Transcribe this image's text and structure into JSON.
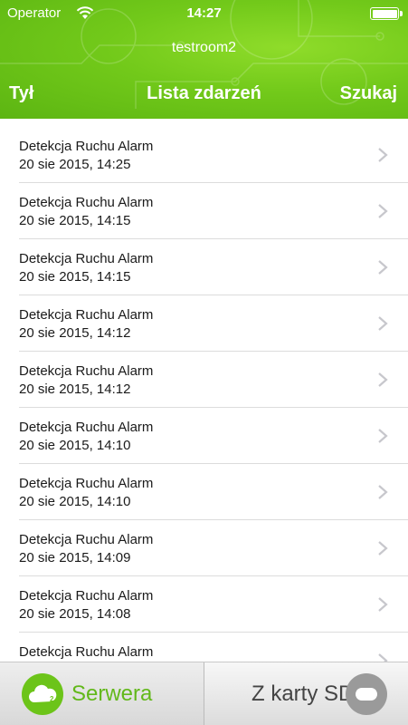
{
  "status_bar": {
    "carrier": "Operator",
    "time": "14:27",
    "icons": [
      "wifi-icon",
      "battery-icon"
    ]
  },
  "header": {
    "subtitle": "testroom2",
    "back_label": "Tył",
    "title": "Lista zdarzeń",
    "search_label": "Szukaj",
    "accent_color": "#72c91a"
  },
  "events": [
    {
      "title": "Detekcja Ruchu Alarm",
      "time": "20 sie 2015, 14:25"
    },
    {
      "title": "Detekcja Ruchu Alarm",
      "time": "20 sie 2015, 14:15"
    },
    {
      "title": "Detekcja Ruchu Alarm",
      "time": "20 sie 2015, 14:15"
    },
    {
      "title": "Detekcja Ruchu Alarm",
      "time": "20 sie 2015, 14:12"
    },
    {
      "title": "Detekcja Ruchu Alarm",
      "time": "20 sie 2015, 14:12"
    },
    {
      "title": "Detekcja Ruchu Alarm",
      "time": "20 sie 2015, 14:10"
    },
    {
      "title": "Detekcja Ruchu Alarm",
      "time": "20 sie 2015, 14:10"
    },
    {
      "title": "Detekcja Ruchu Alarm",
      "time": "20 sie 2015, 14:09"
    },
    {
      "title": "Detekcja Ruchu Alarm",
      "time": "20 sie 2015, 14:08"
    },
    {
      "title": "Detekcja Ruchu Alarm",
      "time": ""
    }
  ],
  "tabbar": {
    "left_label": "Serwera",
    "left_icon": "cloud-icon",
    "right_label": "Z karty SD",
    "right_icon": "toggle-icon",
    "active_color": "#62b81a"
  }
}
